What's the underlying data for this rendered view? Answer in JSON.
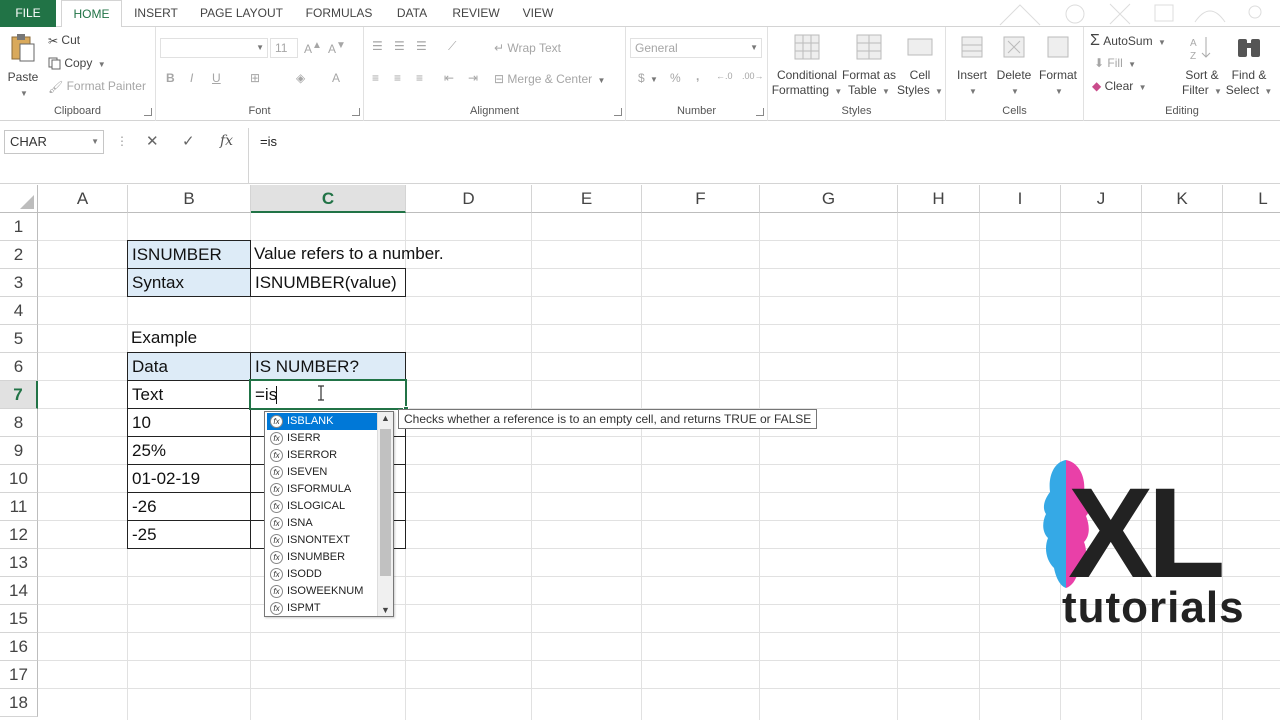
{
  "ribbon_tabs": [
    "FILE",
    "HOME",
    "INSERT",
    "PAGE LAYOUT",
    "FORMULAS",
    "DATA",
    "REVIEW",
    "VIEW"
  ],
  "clipboard": {
    "paste": "Paste",
    "cut": "Cut",
    "copy": "Copy",
    "format_painter": "Format Painter",
    "label": "Clipboard"
  },
  "font": {
    "size": "11",
    "label": "Font"
  },
  "alignment": {
    "wrap_text": "Wrap Text",
    "merge_center": "Merge & Center",
    "label": "Alignment"
  },
  "number": {
    "format": "General",
    "currency": "$",
    "percent": "%",
    "comma": ",",
    "label": "Number"
  },
  "styles": {
    "conditional_formatting": "Conditional Formatting",
    "format_as_table": "Format as Table",
    "cell_styles": "Cell Styles",
    "label": "Styles"
  },
  "cells": {
    "insert": "Insert",
    "delete": "Delete",
    "format": "Format",
    "label": "Cells"
  },
  "editing": {
    "autosum": "AutoSum",
    "fill": "Fill",
    "clear": "Clear",
    "sort_filter": "Sort & Filter",
    "find_select": "Find & Select",
    "label": "Editing"
  },
  "formula_bar": {
    "name_box": "CHAR",
    "cancel": "✕",
    "enter": "✓",
    "fx": "fx",
    "formula": "=is"
  },
  "columns": [
    "A",
    "B",
    "C",
    "D",
    "E",
    "F",
    "G",
    "H",
    "I",
    "J",
    "K",
    "L"
  ],
  "rows": [
    "1",
    "2",
    "3",
    "4",
    "5",
    "6",
    "7",
    "8",
    "9",
    "10",
    "11",
    "12",
    "13",
    "14",
    "15",
    "16",
    "17",
    "18"
  ],
  "cells_content": {
    "b2": "ISNUMBER",
    "c2": "Value refers to a number.",
    "b3": "Syntax",
    "c3": "ISNUMBER(value)",
    "b5": "Example",
    "b6": "Data",
    "c6": "IS NUMBER?",
    "b7": "Text",
    "c7": "=is",
    "b8": "10",
    "b9": "25%",
    "b10": "01-02-19",
    "b11": "-26",
    "b12": "-25"
  },
  "autocomplete": [
    "ISBLANK",
    "ISERR",
    "ISERROR",
    "ISEVEN",
    "ISFORMULA",
    "ISLOGICAL",
    "ISNA",
    "ISNONTEXT",
    "ISNUMBER",
    "ISODD",
    "ISOWEEKNUM",
    "ISPMT"
  ],
  "tooltip": "Checks whether a reference is to an empty cell, and returns TRUE or FALSE",
  "logo": {
    "main": "XL",
    "sub": "tutorials"
  },
  "colors": {
    "excel_green": "#217346",
    "header_blue": "#ddebf7",
    "selection_blue": "#0078d7",
    "logo_pink": "#e940a8",
    "logo_blue": "#35a9e6"
  }
}
